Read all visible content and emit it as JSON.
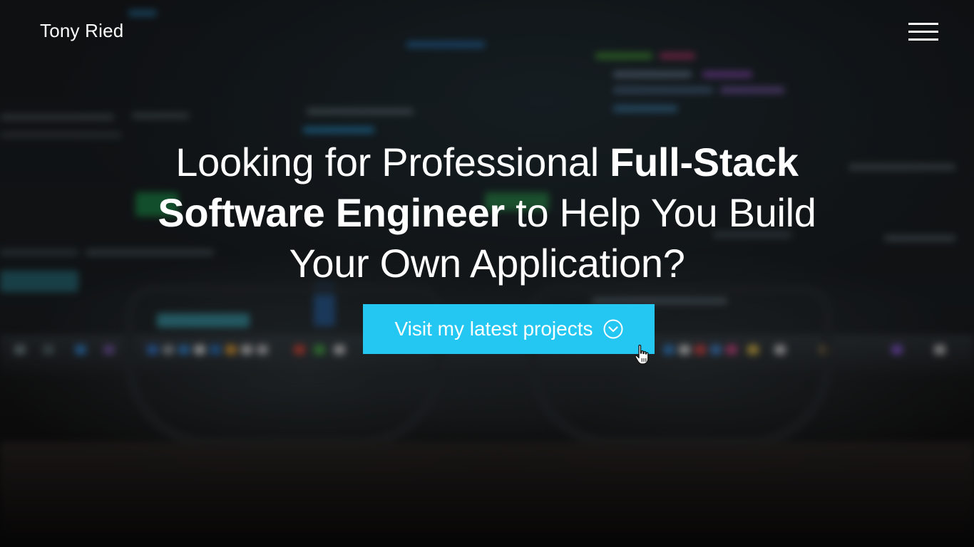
{
  "header": {
    "brand": "Tony Ried",
    "menu_icon": "hamburger-menu-icon"
  },
  "hero": {
    "headline_part1": "Looking for Professional ",
    "headline_bold": "Full-Stack Software Engineer",
    "headline_part2": " to Help You Build Your Own Application?",
    "cta_label": "Visit my latest projects",
    "cta_icon": "chevron-down-circle-icon"
  },
  "colors": {
    "cta_background": "#24c6f2",
    "text": "#ffffff",
    "background": "#16191c"
  }
}
